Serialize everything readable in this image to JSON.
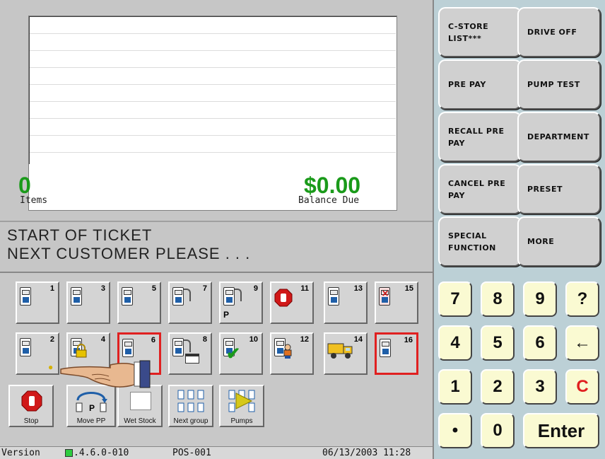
{
  "receipt": {
    "items_count": "0",
    "items_label": "Items",
    "balance_amount": "$0.00",
    "balance_label": "Balance Due"
  },
  "message": {
    "line1": "START OF TICKET",
    "line2": "NEXT CUSTOMER PLEASE . . ."
  },
  "function_keys": [
    {
      "label": "C-STORE LIST***"
    },
    {
      "label": "DRIVE OFF"
    },
    {
      "label": "PRE PAY"
    },
    {
      "label": "PUMP TEST"
    },
    {
      "label": "RECALL PRE PAY"
    },
    {
      "label": "DEPARTMENT"
    },
    {
      "label": "CANCEL PRE PAY"
    },
    {
      "label": "PRESET"
    },
    {
      "label": "SPECIAL FUNCTION"
    },
    {
      "label": "MORE"
    }
  ],
  "pumps": [
    {
      "number": "1",
      "icon": "dispenser-icon"
    },
    {
      "number": "3",
      "icon": "dispenser-icon"
    },
    {
      "number": "5",
      "icon": "dispenser-icon"
    },
    {
      "number": "7",
      "icon": "dispenser-nozzle-out-icon"
    },
    {
      "number": "9",
      "icon": "dispenser-prepay-icon",
      "badge": "P"
    },
    {
      "number": "11",
      "icon": "stop-hand-icon"
    },
    {
      "number": "13",
      "icon": "dispenser-icon"
    },
    {
      "number": "15",
      "icon": "dispenser-error-icon"
    },
    {
      "number": "2",
      "icon": "dispenser-icon"
    },
    {
      "number": "4",
      "icon": "dispenser-locked-icon"
    },
    {
      "number": "6",
      "icon": "dispenser-selected-icon"
    },
    {
      "number": "8",
      "icon": "dispenser-card-icon"
    },
    {
      "number": "10",
      "icon": "dispenser-approved-icon"
    },
    {
      "number": "12",
      "icon": "dispenser-attendant-icon"
    },
    {
      "number": "14",
      "icon": "fuel-truck-icon"
    },
    {
      "number": "16",
      "icon": "dispenser-selected-icon"
    }
  ],
  "commands": [
    {
      "label": "Stop",
      "icon": "stop-icon"
    },
    {
      "label": "Move PP",
      "icon": "move-prepay-icon"
    },
    {
      "label": "Wet Stock",
      "icon": "wet-stock-icon"
    },
    {
      "label": "Next group",
      "icon": "next-group-icon"
    },
    {
      "label": "Pumps",
      "icon": "pumps-play-icon"
    }
  ],
  "keypad": {
    "keys": [
      "7",
      "8",
      "9",
      "?",
      "4",
      "5",
      "6",
      "←",
      "1",
      "2",
      "3",
      "C",
      "•",
      "0"
    ],
    "enter": "Enter",
    "colors": {
      "key_bg": "#fafad2",
      "clear": "#e02020"
    }
  },
  "status_bar": {
    "version": "Version ",
    "version_num": ".4.6.0-010",
    "terminal": "POS-001",
    "datetime": "06/13/2003 11:28"
  },
  "colors": {
    "amount_green": "#1a9a1a",
    "selected_border": "#e02020",
    "panel_blue": "#bcd0d6"
  }
}
